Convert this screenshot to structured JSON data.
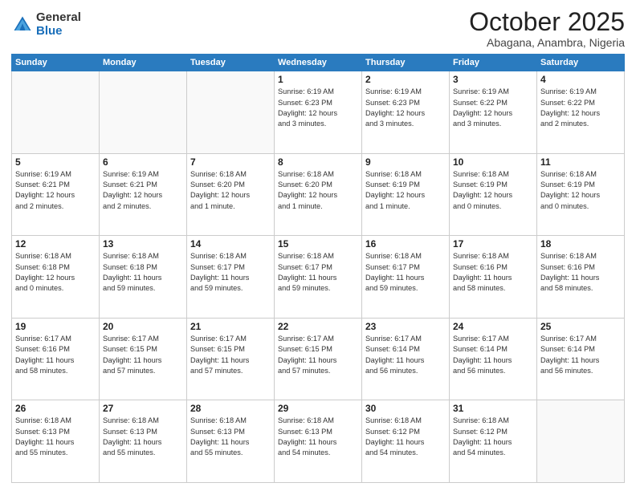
{
  "header": {
    "logo": {
      "general": "General",
      "blue": "Blue"
    },
    "title": "October 2025",
    "subtitle": "Abagana, Anambra, Nigeria"
  },
  "weekdays": [
    "Sunday",
    "Monday",
    "Tuesday",
    "Wednesday",
    "Thursday",
    "Friday",
    "Saturday"
  ],
  "weeks": [
    [
      {
        "day": "",
        "info": ""
      },
      {
        "day": "",
        "info": ""
      },
      {
        "day": "",
        "info": ""
      },
      {
        "day": "1",
        "info": "Sunrise: 6:19 AM\nSunset: 6:23 PM\nDaylight: 12 hours\nand 3 minutes."
      },
      {
        "day": "2",
        "info": "Sunrise: 6:19 AM\nSunset: 6:23 PM\nDaylight: 12 hours\nand 3 minutes."
      },
      {
        "day": "3",
        "info": "Sunrise: 6:19 AM\nSunset: 6:22 PM\nDaylight: 12 hours\nand 3 minutes."
      },
      {
        "day": "4",
        "info": "Sunrise: 6:19 AM\nSunset: 6:22 PM\nDaylight: 12 hours\nand 2 minutes."
      }
    ],
    [
      {
        "day": "5",
        "info": "Sunrise: 6:19 AM\nSunset: 6:21 PM\nDaylight: 12 hours\nand 2 minutes."
      },
      {
        "day": "6",
        "info": "Sunrise: 6:19 AM\nSunset: 6:21 PM\nDaylight: 12 hours\nand 2 minutes."
      },
      {
        "day": "7",
        "info": "Sunrise: 6:18 AM\nSunset: 6:20 PM\nDaylight: 12 hours\nand 1 minute."
      },
      {
        "day": "8",
        "info": "Sunrise: 6:18 AM\nSunset: 6:20 PM\nDaylight: 12 hours\nand 1 minute."
      },
      {
        "day": "9",
        "info": "Sunrise: 6:18 AM\nSunset: 6:19 PM\nDaylight: 12 hours\nand 1 minute."
      },
      {
        "day": "10",
        "info": "Sunrise: 6:18 AM\nSunset: 6:19 PM\nDaylight: 12 hours\nand 0 minutes."
      },
      {
        "day": "11",
        "info": "Sunrise: 6:18 AM\nSunset: 6:19 PM\nDaylight: 12 hours\nand 0 minutes."
      }
    ],
    [
      {
        "day": "12",
        "info": "Sunrise: 6:18 AM\nSunset: 6:18 PM\nDaylight: 12 hours\nand 0 minutes."
      },
      {
        "day": "13",
        "info": "Sunrise: 6:18 AM\nSunset: 6:18 PM\nDaylight: 11 hours\nand 59 minutes."
      },
      {
        "day": "14",
        "info": "Sunrise: 6:18 AM\nSunset: 6:17 PM\nDaylight: 11 hours\nand 59 minutes."
      },
      {
        "day": "15",
        "info": "Sunrise: 6:18 AM\nSunset: 6:17 PM\nDaylight: 11 hours\nand 59 minutes."
      },
      {
        "day": "16",
        "info": "Sunrise: 6:18 AM\nSunset: 6:17 PM\nDaylight: 11 hours\nand 59 minutes."
      },
      {
        "day": "17",
        "info": "Sunrise: 6:18 AM\nSunset: 6:16 PM\nDaylight: 11 hours\nand 58 minutes."
      },
      {
        "day": "18",
        "info": "Sunrise: 6:18 AM\nSunset: 6:16 PM\nDaylight: 11 hours\nand 58 minutes."
      }
    ],
    [
      {
        "day": "19",
        "info": "Sunrise: 6:17 AM\nSunset: 6:16 PM\nDaylight: 11 hours\nand 58 minutes."
      },
      {
        "day": "20",
        "info": "Sunrise: 6:17 AM\nSunset: 6:15 PM\nDaylight: 11 hours\nand 57 minutes."
      },
      {
        "day": "21",
        "info": "Sunrise: 6:17 AM\nSunset: 6:15 PM\nDaylight: 11 hours\nand 57 minutes."
      },
      {
        "day": "22",
        "info": "Sunrise: 6:17 AM\nSunset: 6:15 PM\nDaylight: 11 hours\nand 57 minutes."
      },
      {
        "day": "23",
        "info": "Sunrise: 6:17 AM\nSunset: 6:14 PM\nDaylight: 11 hours\nand 56 minutes."
      },
      {
        "day": "24",
        "info": "Sunrise: 6:17 AM\nSunset: 6:14 PM\nDaylight: 11 hours\nand 56 minutes."
      },
      {
        "day": "25",
        "info": "Sunrise: 6:17 AM\nSunset: 6:14 PM\nDaylight: 11 hours\nand 56 minutes."
      }
    ],
    [
      {
        "day": "26",
        "info": "Sunrise: 6:18 AM\nSunset: 6:13 PM\nDaylight: 11 hours\nand 55 minutes."
      },
      {
        "day": "27",
        "info": "Sunrise: 6:18 AM\nSunset: 6:13 PM\nDaylight: 11 hours\nand 55 minutes."
      },
      {
        "day": "28",
        "info": "Sunrise: 6:18 AM\nSunset: 6:13 PM\nDaylight: 11 hours\nand 55 minutes."
      },
      {
        "day": "29",
        "info": "Sunrise: 6:18 AM\nSunset: 6:13 PM\nDaylight: 11 hours\nand 54 minutes."
      },
      {
        "day": "30",
        "info": "Sunrise: 6:18 AM\nSunset: 6:12 PM\nDaylight: 11 hours\nand 54 minutes."
      },
      {
        "day": "31",
        "info": "Sunrise: 6:18 AM\nSunset: 6:12 PM\nDaylight: 11 hours\nand 54 minutes."
      },
      {
        "day": "",
        "info": ""
      }
    ]
  ]
}
